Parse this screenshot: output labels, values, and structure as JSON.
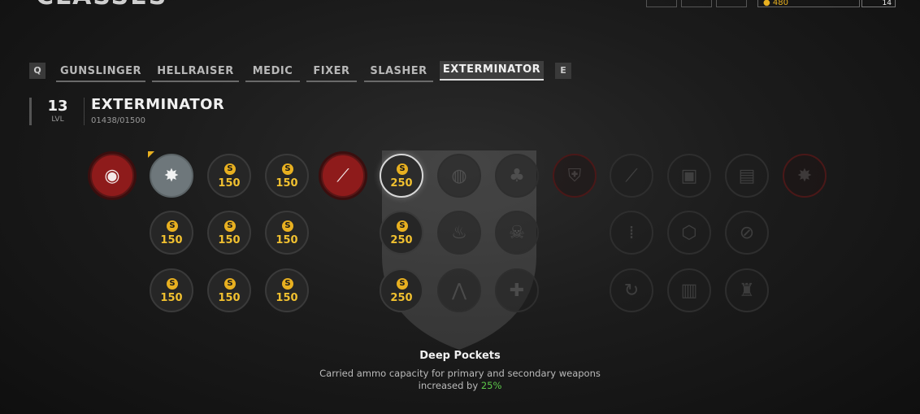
{
  "header": {
    "title": "CLASSES",
    "currency": "480",
    "player_level": "14"
  },
  "tabs": {
    "prev_key": "Q",
    "next_key": "E",
    "items": [
      {
        "label": "GUNSLINGER"
      },
      {
        "label": "HELLRAISER"
      },
      {
        "label": "MEDIC"
      },
      {
        "label": "FIXER"
      },
      {
        "label": "SLASHER"
      },
      {
        "label": "EXTERMINATOR"
      }
    ],
    "active_index": 5
  },
  "class_info": {
    "level": "13",
    "level_label": "LVL",
    "name": "EXTERMINATOR",
    "xp": "01438/01500"
  },
  "skill_tree": {
    "coin_symbol": "S",
    "nodes": [
      {
        "kind": "red",
        "icon": "class-ability-icon"
      },
      {
        "kind": "grey",
        "icon": "explosive-icon"
      },
      {
        "kind": "cost",
        "cost": "150"
      },
      {
        "kind": "cost",
        "cost": "150"
      },
      {
        "kind": "red",
        "icon": "mortar-icon"
      },
      {
        "kind": "selected",
        "cost": "250"
      },
      {
        "kind": "locked",
        "icon": "grenade-icon"
      },
      {
        "kind": "locked",
        "icon": "clover-icon"
      },
      {
        "kind": "redlock",
        "icon": "shield-icon"
      },
      {
        "kind": "locked",
        "icon": "rifle-icon"
      },
      {
        "kind": "locked",
        "icon": "backpack-icon"
      },
      {
        "kind": "locked",
        "icon": "ammo-box-icon"
      },
      {
        "kind": "redlock",
        "icon": "explosive-icon"
      },
      {
        "kind": "cost",
        "cost": "150"
      },
      {
        "kind": "cost",
        "cost": "150"
      },
      {
        "kind": "cost",
        "cost": "150"
      },
      {
        "kind": "cost",
        "cost": "250"
      },
      {
        "kind": "locked",
        "icon": "fire-icon"
      },
      {
        "kind": "locked",
        "icon": "skull-icon"
      },
      {
        "kind": "locked",
        "icon": "bullets-icon"
      },
      {
        "kind": "locked",
        "icon": "nut-icon"
      },
      {
        "kind": "locked",
        "icon": "compass-icon"
      },
      {
        "kind": "cost",
        "cost": "150"
      },
      {
        "kind": "cost",
        "cost": "150"
      },
      {
        "kind": "cost",
        "cost": "150"
      },
      {
        "kind": "cost",
        "cost": "250"
      },
      {
        "kind": "locked",
        "icon": "tripod-icon"
      },
      {
        "kind": "locked",
        "icon": "grenade-plus-icon"
      },
      {
        "kind": "locked",
        "icon": "reload-icon"
      },
      {
        "kind": "locked",
        "icon": "crate-icon"
      },
      {
        "kind": "locked",
        "icon": "soldier-icon"
      }
    ]
  },
  "perk": {
    "name": "Deep Pockets",
    "desc_1": "Carried ammo capacity for primary and secondary weapons",
    "desc_2": "increased by ",
    "value": "25%",
    "value_color": "#5cc74a"
  },
  "colors": {
    "accent_gold": "#e8b020",
    "ability_red": "#8e1b1b"
  }
}
